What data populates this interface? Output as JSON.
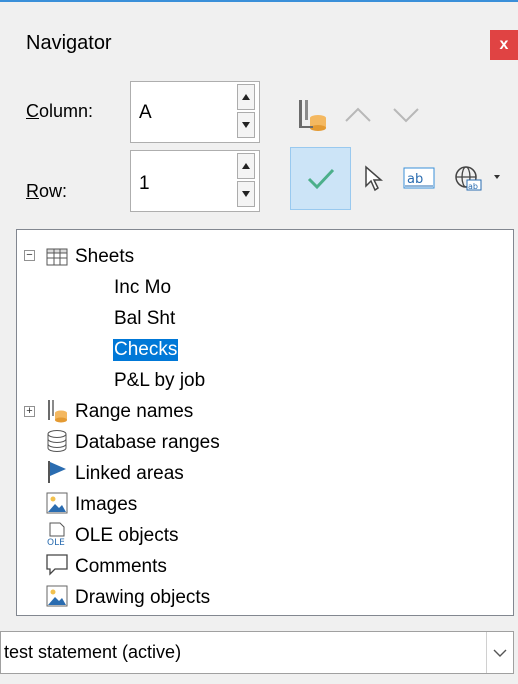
{
  "window": {
    "title": "Navigator",
    "close_glyph": "x"
  },
  "column": {
    "label": "Column:",
    "value": "A"
  },
  "row": {
    "label": "Row:",
    "value": "1"
  },
  "toolbar": {
    "icons": [
      "range-names-icon",
      "previous-icon",
      "next-icon",
      "content-view-icon",
      "drag-mode-icon",
      "insert-as-hyperlink-icon",
      "global-icon"
    ],
    "content_view_active": true
  },
  "tree": {
    "sheets": {
      "label": "Sheets",
      "expanded": true,
      "children": [
        "Inc Mo",
        "Bal Sht",
        "Checks",
        "P&L by job"
      ],
      "selected": "Checks"
    },
    "categories": [
      {
        "label": "Range names",
        "expandable": true
      },
      {
        "label": "Database ranges",
        "expandable": false
      },
      {
        "label": "Linked areas",
        "expandable": false
      },
      {
        "label": "Images",
        "expandable": false
      },
      {
        "label": "OLE objects",
        "expandable": false
      },
      {
        "label": "Comments",
        "expandable": false
      },
      {
        "label": "Drawing objects",
        "expandable": false
      }
    ],
    "expand_glyph": "+",
    "collapse_glyph": "−"
  },
  "document_select": {
    "value": "test statement (active)"
  },
  "colors": {
    "accent": "#3a8fd9",
    "selection": "#0078d7",
    "close": "#e04343",
    "pressed": "#cce4f7"
  }
}
